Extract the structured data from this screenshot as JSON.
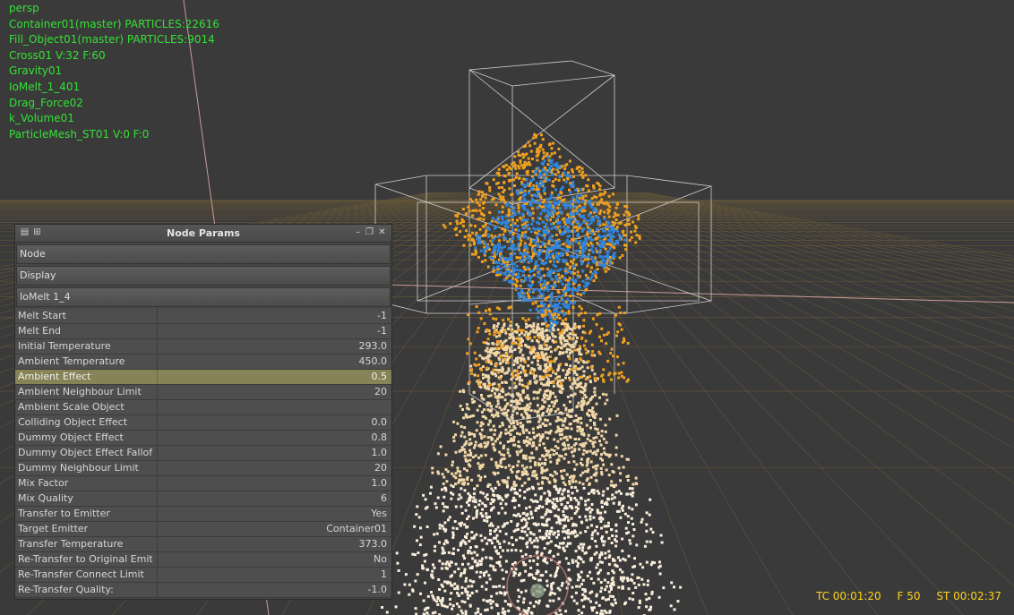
{
  "hud": {
    "lines": [
      "persp",
      "Container01(master) PARTICLES:22616",
      "Fill_Object01(master) PARTICLES:9014",
      "Cross01 V:32 F:60",
      "Gravity01",
      "IoMelt_1_401",
      "Drag_Force02",
      "k_Volume01",
      "ParticleMesh_ST01 V:0 F:0"
    ],
    "color": "#35e035"
  },
  "timecode": {
    "tc": "TC 00:01:20",
    "frame": "F 50",
    "st": "ST 00:02:37",
    "color": "#ffd21e"
  },
  "panel": {
    "title": "Node Params",
    "icons": [
      "panel-menu-icon",
      "panel-grid-icon",
      "minimize-icon",
      "restore-icon",
      "close-icon"
    ],
    "sections": [
      "Node",
      "Display",
      "IoMelt 1_4"
    ],
    "params": [
      {
        "name": "Melt Start",
        "value": "-1"
      },
      {
        "name": "Melt End",
        "value": "-1"
      },
      {
        "name": "Initial Temperature",
        "value": "293.0"
      },
      {
        "name": "Ambient Temperature",
        "value": "450.0"
      },
      {
        "name": "Ambient Effect",
        "value": "0.5"
      },
      {
        "name": "Ambient Neighbour Limit",
        "value": "20"
      },
      {
        "name": "Ambient Scale Object",
        "value": ""
      },
      {
        "name": "Colliding Object Effect",
        "value": "0.0"
      },
      {
        "name": "Dummy Object Effect",
        "value": "0.8"
      },
      {
        "name": "Dummy Object Effect Falloff",
        "value": "1.0"
      },
      {
        "name": "Dummy Neighbour Limit",
        "value": "20"
      },
      {
        "name": "Mix Factor",
        "value": "1.0"
      },
      {
        "name": "Mix Quality",
        "value": "6"
      },
      {
        "name": "Transfer to Emitter",
        "value": "Yes"
      },
      {
        "name": "Target Emitter",
        "value": "Container01"
      },
      {
        "name": "Transfer Temperature",
        "value": "373.0"
      },
      {
        "name": "Re-Transfer to Original Emitter",
        "value": "No"
      },
      {
        "name": "Re-Transfer Connect Limit",
        "value": "1"
      },
      {
        "name": "Re-Transfer Quality:",
        "value": "-1.0"
      }
    ],
    "selected_param": "Ambient Effect",
    "selected_color": "#868356"
  },
  "colors": {
    "viewport_bg": "#3a3a3a",
    "grid": "#6b5a38",
    "particles_orange": "#f0a020",
    "particles_blue": "#2f86e0",
    "particles_cream": "#f2d8a8"
  }
}
